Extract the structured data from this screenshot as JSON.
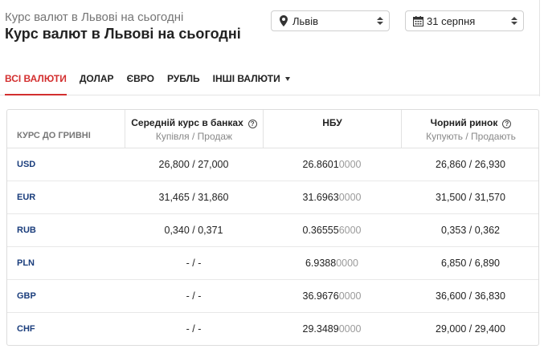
{
  "header": {
    "subtitle": "Курс валют в Львові на сьогодні",
    "title": "Курс валют в Львові на сьогодні",
    "city_select": {
      "value": "Львів",
      "icon": "map-pin-icon"
    },
    "date_select": {
      "value": "31 серпня",
      "icon": "calendar-icon"
    }
  },
  "tabs": [
    {
      "label": "ВСІ ВАЛЮТИ",
      "active": true
    },
    {
      "label": "ДОЛАР"
    },
    {
      "label": "ЄВРО"
    },
    {
      "label": "РУБЛЬ"
    },
    {
      "label": "ІНШІ ВАЛЮТИ"
    }
  ],
  "table": {
    "col0_label": "КУРС ДО ГРИВНІ",
    "col1": {
      "title": "Середній курс в банках",
      "sub": "Купівля / Продаж"
    },
    "col2": {
      "title": "НБУ"
    },
    "col3": {
      "title": "Чорний ринок",
      "sub": "Купують / Продають"
    },
    "rows": [
      {
        "code": "USD",
        "bank": "26,800 / 27,000",
        "nbu_main": "26.8601",
        "nbu_rest": "0000",
        "black": "26,860 / 26,930"
      },
      {
        "code": "EUR",
        "bank": "31,465 / 31,860",
        "nbu_main": "31.6963",
        "nbu_rest": "0000",
        "black": "31,500 / 31,570"
      },
      {
        "code": "RUB",
        "bank": "0,340 / 0,371",
        "nbu_main": "0.36555",
        "nbu_rest": "6000",
        "black": "0,353 / 0,362"
      },
      {
        "code": "PLN",
        "bank": "- / -",
        "nbu_main": "6.9388",
        "nbu_rest": "0000",
        "black": "6,850 / 6,890"
      },
      {
        "code": "GBP",
        "bank": "- / -",
        "nbu_main": "36.9676",
        "nbu_rest": "0000",
        "black": "36,600 / 36,830"
      },
      {
        "code": "CHF",
        "bank": "- / -",
        "nbu_main": "29.3489",
        "nbu_rest": "0000",
        "black": "29,000 / 29,400"
      }
    ]
  },
  "colors": {
    "accent": "#d32f2f",
    "code": "#1a3d7c"
  }
}
